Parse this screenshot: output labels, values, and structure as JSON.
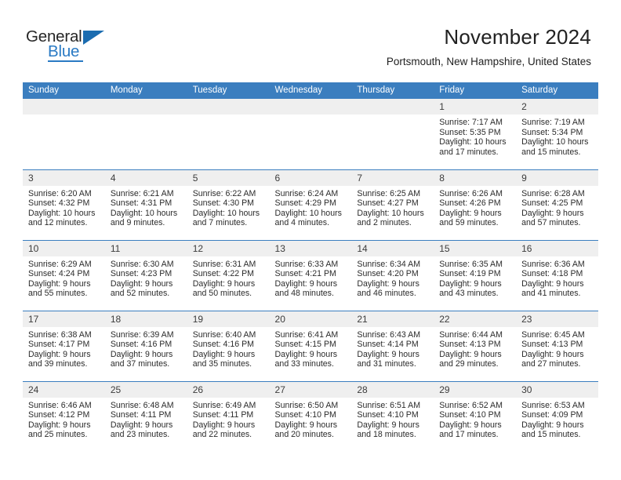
{
  "brand": {
    "name_top": "General",
    "name_bottom": "Blue",
    "top_color": "#262626",
    "bottom_color": "#2a7ac4",
    "triangle_color": "#1b6cb0"
  },
  "header": {
    "title": "November 2024",
    "subtitle": "Portsmouth, New Hampshire, United States",
    "accent_color": "#3b7ebf",
    "daynum_band_color": "#efefef"
  },
  "weekday_headers": [
    "Sunday",
    "Monday",
    "Tuesday",
    "Wednesday",
    "Thursday",
    "Friday",
    "Saturday"
  ],
  "labels": {
    "sunrise_prefix": "Sunrise:",
    "sunset_prefix": "Sunset:",
    "daylight_prefix": "Daylight:"
  },
  "weeks": [
    [
      {
        "day": "",
        "blank": true
      },
      {
        "day": "",
        "blank": true
      },
      {
        "day": "",
        "blank": true
      },
      {
        "day": "",
        "blank": true
      },
      {
        "day": "",
        "blank": true
      },
      {
        "day": "1",
        "sunrise": "Sunrise: 7:17 AM",
        "sunset": "Sunset: 5:35 PM",
        "daylight": "Daylight: 10 hours and 17 minutes."
      },
      {
        "day": "2",
        "sunrise": "Sunrise: 7:19 AM",
        "sunset": "Sunset: 5:34 PM",
        "daylight": "Daylight: 10 hours and 15 minutes."
      }
    ],
    [
      {
        "day": "3",
        "sunrise": "Sunrise: 6:20 AM",
        "sunset": "Sunset: 4:32 PM",
        "daylight": "Daylight: 10 hours and 12 minutes."
      },
      {
        "day": "4",
        "sunrise": "Sunrise: 6:21 AM",
        "sunset": "Sunset: 4:31 PM",
        "daylight": "Daylight: 10 hours and 9 minutes."
      },
      {
        "day": "5",
        "sunrise": "Sunrise: 6:22 AM",
        "sunset": "Sunset: 4:30 PM",
        "daylight": "Daylight: 10 hours and 7 minutes."
      },
      {
        "day": "6",
        "sunrise": "Sunrise: 6:24 AM",
        "sunset": "Sunset: 4:29 PM",
        "daylight": "Daylight: 10 hours and 4 minutes."
      },
      {
        "day": "7",
        "sunrise": "Sunrise: 6:25 AM",
        "sunset": "Sunset: 4:27 PM",
        "daylight": "Daylight: 10 hours and 2 minutes."
      },
      {
        "day": "8",
        "sunrise": "Sunrise: 6:26 AM",
        "sunset": "Sunset: 4:26 PM",
        "daylight": "Daylight: 9 hours and 59 minutes."
      },
      {
        "day": "9",
        "sunrise": "Sunrise: 6:28 AM",
        "sunset": "Sunset: 4:25 PM",
        "daylight": "Daylight: 9 hours and 57 minutes."
      }
    ],
    [
      {
        "day": "10",
        "sunrise": "Sunrise: 6:29 AM",
        "sunset": "Sunset: 4:24 PM",
        "daylight": "Daylight: 9 hours and 55 minutes."
      },
      {
        "day": "11",
        "sunrise": "Sunrise: 6:30 AM",
        "sunset": "Sunset: 4:23 PM",
        "daylight": "Daylight: 9 hours and 52 minutes."
      },
      {
        "day": "12",
        "sunrise": "Sunrise: 6:31 AM",
        "sunset": "Sunset: 4:22 PM",
        "daylight": "Daylight: 9 hours and 50 minutes."
      },
      {
        "day": "13",
        "sunrise": "Sunrise: 6:33 AM",
        "sunset": "Sunset: 4:21 PM",
        "daylight": "Daylight: 9 hours and 48 minutes."
      },
      {
        "day": "14",
        "sunrise": "Sunrise: 6:34 AM",
        "sunset": "Sunset: 4:20 PM",
        "daylight": "Daylight: 9 hours and 46 minutes."
      },
      {
        "day": "15",
        "sunrise": "Sunrise: 6:35 AM",
        "sunset": "Sunset: 4:19 PM",
        "daylight": "Daylight: 9 hours and 43 minutes."
      },
      {
        "day": "16",
        "sunrise": "Sunrise: 6:36 AM",
        "sunset": "Sunset: 4:18 PM",
        "daylight": "Daylight: 9 hours and 41 minutes."
      }
    ],
    [
      {
        "day": "17",
        "sunrise": "Sunrise: 6:38 AM",
        "sunset": "Sunset: 4:17 PM",
        "daylight": "Daylight: 9 hours and 39 minutes."
      },
      {
        "day": "18",
        "sunrise": "Sunrise: 6:39 AM",
        "sunset": "Sunset: 4:16 PM",
        "daylight": "Daylight: 9 hours and 37 minutes."
      },
      {
        "day": "19",
        "sunrise": "Sunrise: 6:40 AM",
        "sunset": "Sunset: 4:16 PM",
        "daylight": "Daylight: 9 hours and 35 minutes."
      },
      {
        "day": "20",
        "sunrise": "Sunrise: 6:41 AM",
        "sunset": "Sunset: 4:15 PM",
        "daylight": "Daylight: 9 hours and 33 minutes."
      },
      {
        "day": "21",
        "sunrise": "Sunrise: 6:43 AM",
        "sunset": "Sunset: 4:14 PM",
        "daylight": "Daylight: 9 hours and 31 minutes."
      },
      {
        "day": "22",
        "sunrise": "Sunrise: 6:44 AM",
        "sunset": "Sunset: 4:13 PM",
        "daylight": "Daylight: 9 hours and 29 minutes."
      },
      {
        "day": "23",
        "sunrise": "Sunrise: 6:45 AM",
        "sunset": "Sunset: 4:13 PM",
        "daylight": "Daylight: 9 hours and 27 minutes."
      }
    ],
    [
      {
        "day": "24",
        "sunrise": "Sunrise: 6:46 AM",
        "sunset": "Sunset: 4:12 PM",
        "daylight": "Daylight: 9 hours and 25 minutes."
      },
      {
        "day": "25",
        "sunrise": "Sunrise: 6:48 AM",
        "sunset": "Sunset: 4:11 PM",
        "daylight": "Daylight: 9 hours and 23 minutes."
      },
      {
        "day": "26",
        "sunrise": "Sunrise: 6:49 AM",
        "sunset": "Sunset: 4:11 PM",
        "daylight": "Daylight: 9 hours and 22 minutes."
      },
      {
        "day": "27",
        "sunrise": "Sunrise: 6:50 AM",
        "sunset": "Sunset: 4:10 PM",
        "daylight": "Daylight: 9 hours and 20 minutes."
      },
      {
        "day": "28",
        "sunrise": "Sunrise: 6:51 AM",
        "sunset": "Sunset: 4:10 PM",
        "daylight": "Daylight: 9 hours and 18 minutes."
      },
      {
        "day": "29",
        "sunrise": "Sunrise: 6:52 AM",
        "sunset": "Sunset: 4:10 PM",
        "daylight": "Daylight: 9 hours and 17 minutes."
      },
      {
        "day": "30",
        "sunrise": "Sunrise: 6:53 AM",
        "sunset": "Sunset: 4:09 PM",
        "daylight": "Daylight: 9 hours and 15 minutes."
      }
    ]
  ]
}
